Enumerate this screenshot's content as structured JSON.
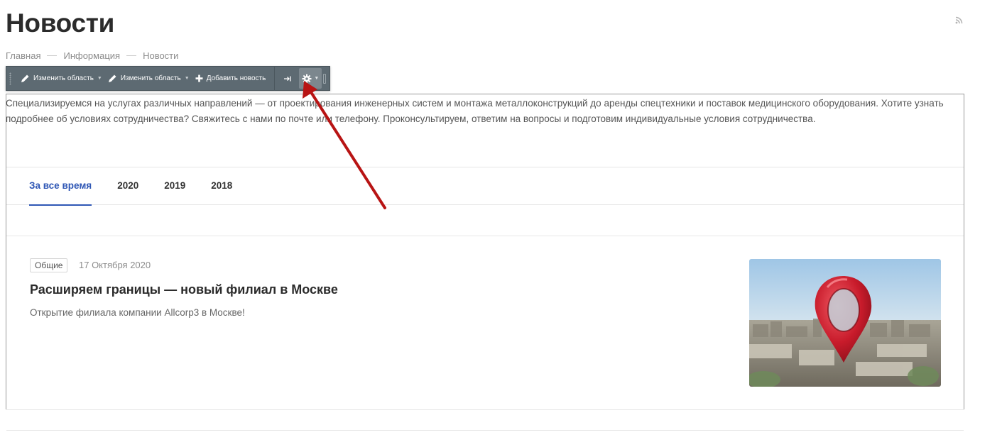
{
  "page": {
    "title": "Новости"
  },
  "breadcrumb": {
    "items": [
      "Главная",
      "Информация",
      "Новости"
    ]
  },
  "toolbar": {
    "edit_area_1": "Изменить область",
    "edit_area_2": "Изменить область",
    "add_news": "Добавить новость"
  },
  "intro": {
    "text": "Специализируемся на услугах различных направлений — от проектирования инженерных систем и монтажа металлоконструкций до аренды спецтехники и поставок медицинского оборудования. Хотите узнать подробнее об условиях сотрудничества? Свяжитесь с нами по почте или телефону. Проконсультируем, ответим на вопросы и подготовим индивидуальные условия сотрудничества."
  },
  "tabs": [
    {
      "label": "За все время",
      "active": true
    },
    {
      "label": "2020",
      "active": false
    },
    {
      "label": "2019",
      "active": false
    },
    {
      "label": "2018",
      "active": false
    }
  ],
  "news": [
    {
      "tag": "Общие",
      "date": "17 Октября 2020",
      "title": "Расширяем границы — новый филиал в Москве",
      "description": "Открытие филиала компании Allcorp3 в Москве!"
    }
  ],
  "colors": {
    "accent": "#2f57b5",
    "toolbar_bg": "#5d6a72",
    "annotation_arrow": "#b81414"
  }
}
